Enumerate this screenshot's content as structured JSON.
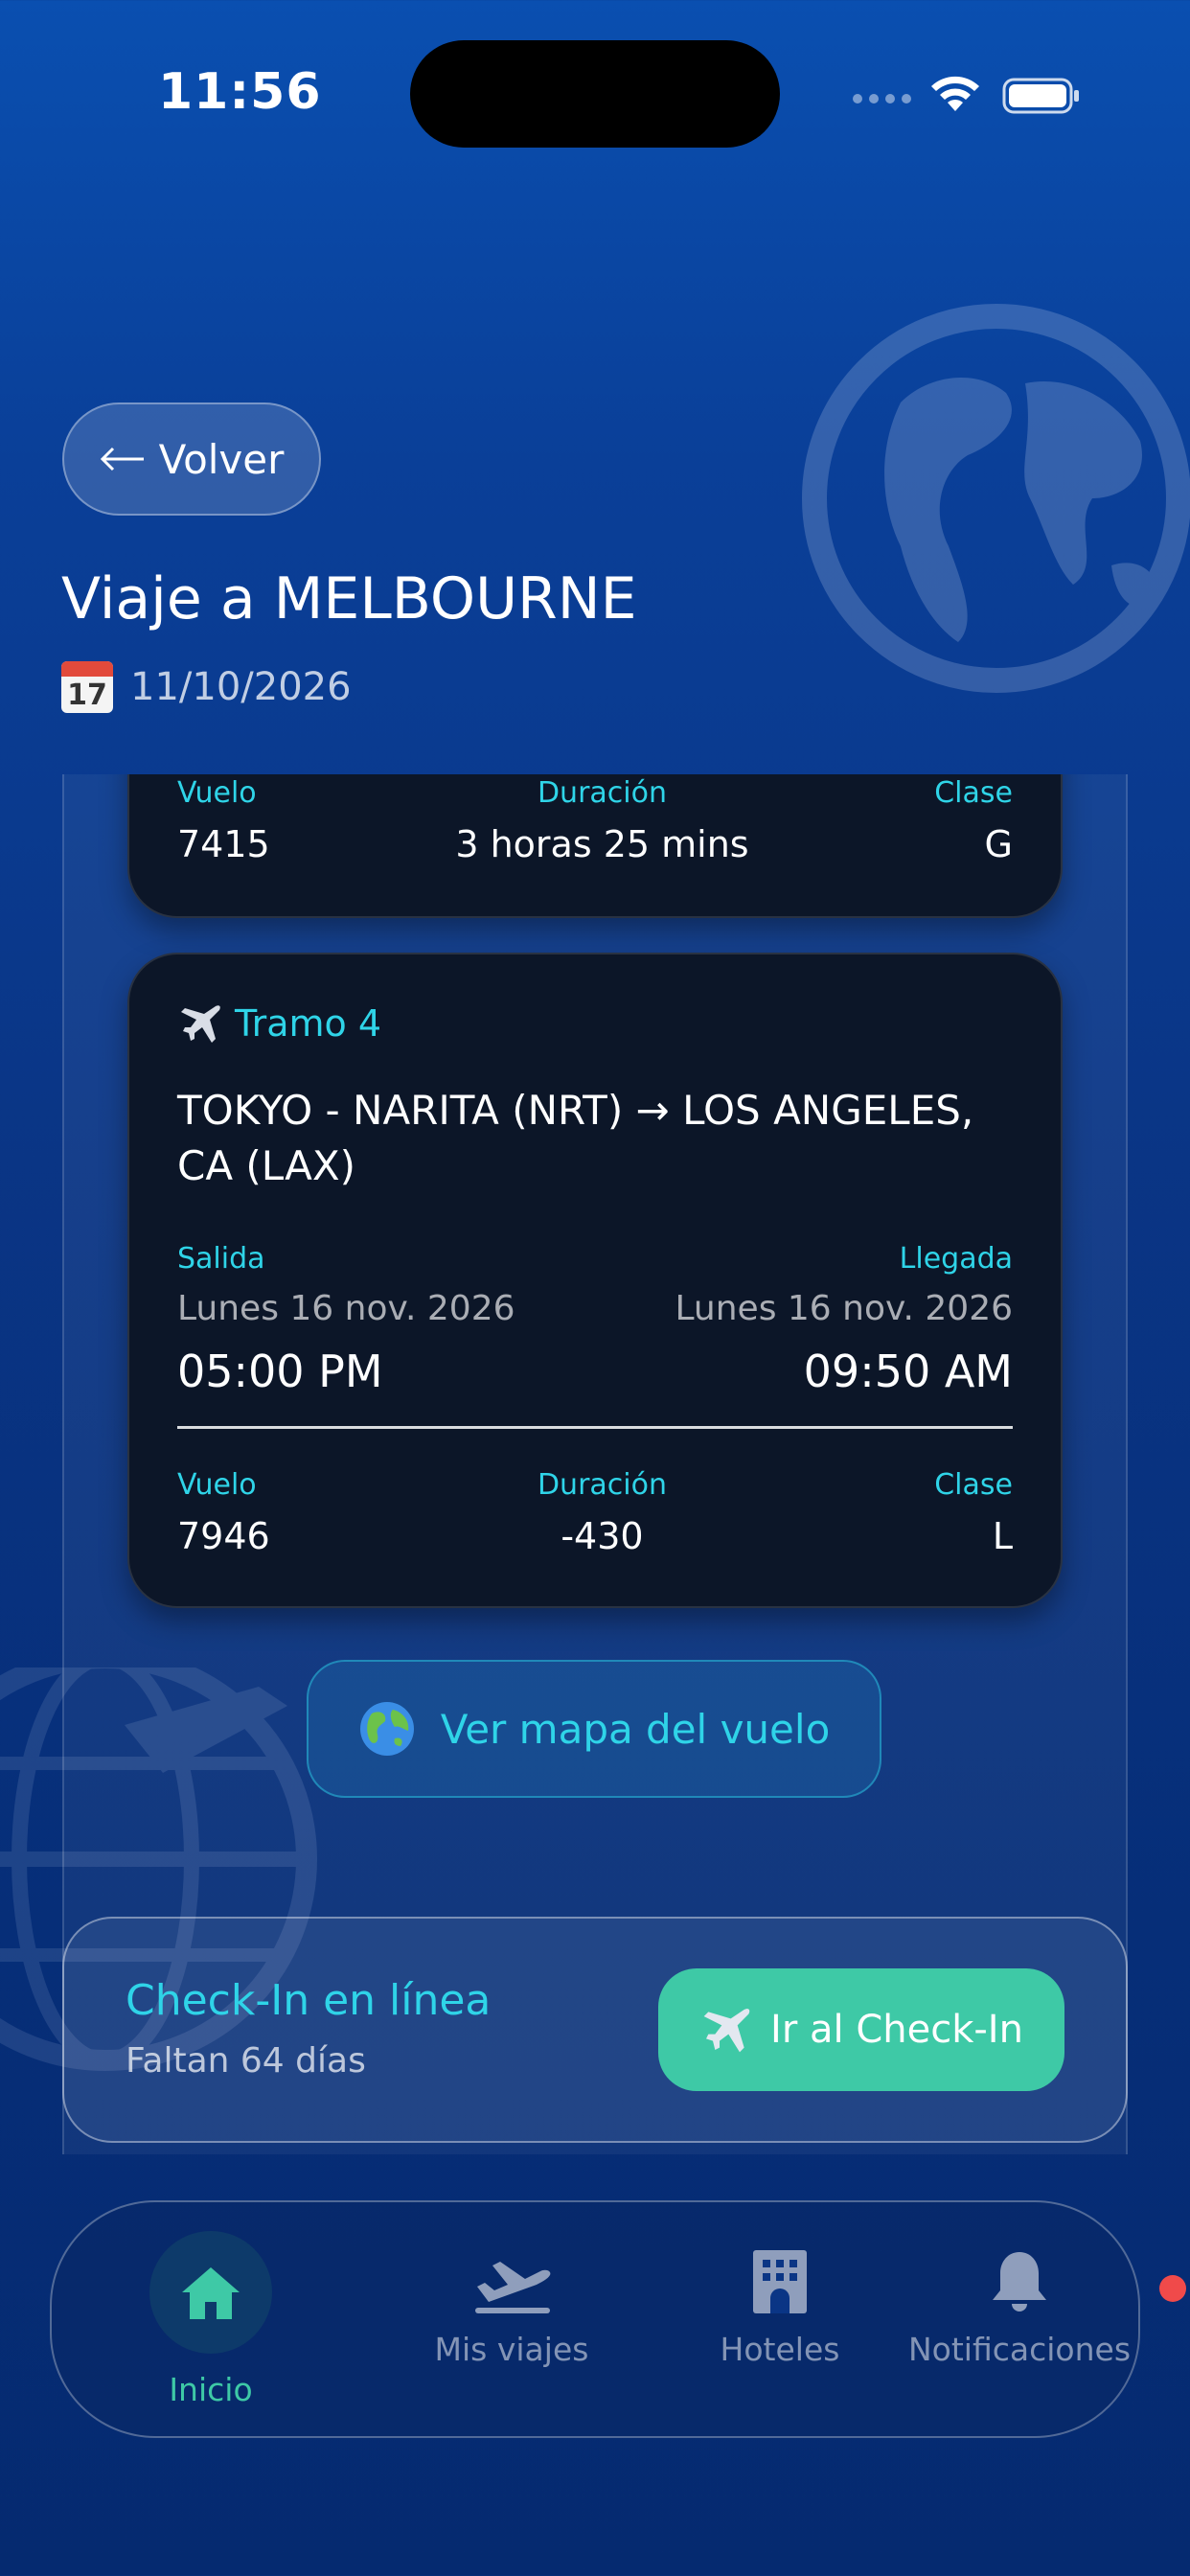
{
  "status_bar": {
    "time": "11:56"
  },
  "header": {
    "back_label": "Volver",
    "title": "Viaje a MELBOURNE",
    "calendar_day": "17",
    "date": "11/10/2026"
  },
  "leg3_footer": {
    "flight_label": "Vuelo",
    "flight": "7415",
    "duration_label": "Duración",
    "duration": "3 horas 25 mins",
    "class_label": "Clase",
    "class": "G"
  },
  "leg4": {
    "heading": "Tramo 4",
    "route": "TOKYO - NARITA (NRT) → LOS ANGELES, CA (LAX)",
    "departure_label": "Salida",
    "departure_date": "Lunes 16 nov. 2026",
    "departure_time": "05:00 PM",
    "arrival_label": "Llegada",
    "arrival_date": "Lunes 16 nov. 2026",
    "arrival_time": "09:50 AM",
    "flight_label": "Vuelo",
    "flight": "7946",
    "duration_label": "Duración",
    "duration": "-430",
    "class_label": "Clase",
    "class": "L"
  },
  "map_button": {
    "label": "Ver mapa del vuelo"
  },
  "checkin": {
    "title": "Check-In en línea",
    "subtitle": "Faltan 64 días",
    "button_label": "Ir al Check-In"
  },
  "tabbar": {
    "tabs": [
      {
        "label": "Inicio",
        "icon": "home-icon",
        "active": true
      },
      {
        "label": "Mis viajes",
        "icon": "plane-departure-icon",
        "active": false
      },
      {
        "label": "Hoteles",
        "icon": "hotel-icon",
        "active": false
      },
      {
        "label": "Notificaciones",
        "icon": "bell-icon",
        "active": false
      }
    ]
  },
  "colors": {
    "accent_cyan": "#2fd4e8",
    "accent_green": "#3ec9a6",
    "card_bg": "#0c1628",
    "badge_red": "#f04a4a"
  }
}
